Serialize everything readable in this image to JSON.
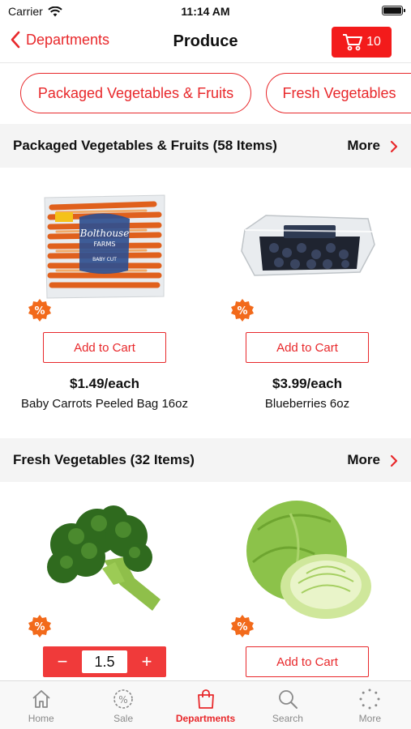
{
  "status": {
    "carrier": "Carrier",
    "time": "11:14 AM"
  },
  "nav": {
    "back_label": "Departments",
    "title": "Produce",
    "cart_count": "10"
  },
  "chips": [
    "Packaged Vegetables & Fruits",
    "Fresh Vegetables"
  ],
  "sections": [
    {
      "title": "Packaged Vegetables & Fruits (58 Items)",
      "more_label": "More",
      "products": [
        {
          "name": "Baby Carrots Peeled Bag 16oz",
          "price": "$1.49/each",
          "add_label": "Add to Cart",
          "bag_brand": "Bolthouse",
          "bag_brand2": "FARMS",
          "bag_tag": "BABY CUT"
        },
        {
          "name": "Blueberries  6oz",
          "price": "$3.99/each",
          "add_label": "Add to Cart"
        }
      ]
    },
    {
      "title": "Fresh Vegetables (32 Items)",
      "more_label": "More",
      "products": [
        {
          "name": "Broccoli",
          "quantity": "1.5"
        },
        {
          "name": "Cabbage",
          "add_label": "Add to Cart"
        }
      ]
    }
  ],
  "sale_badge": "%",
  "tabs": [
    {
      "label": "Home",
      "icon": "home-icon"
    },
    {
      "label": "Sale",
      "icon": "sale-icon"
    },
    {
      "label": "Departments",
      "icon": "bag-icon",
      "active": true
    },
    {
      "label": "Search",
      "icon": "search-icon"
    },
    {
      "label": "More",
      "icon": "more-icon"
    }
  ],
  "colors": {
    "accent": "#e8282b",
    "cart": "#f31b1b",
    "badge": "#f26a1b"
  }
}
